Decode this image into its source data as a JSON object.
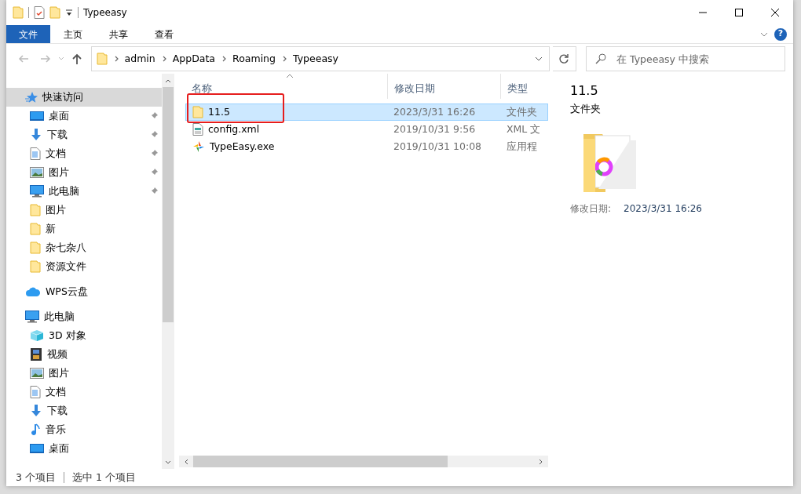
{
  "window": {
    "title": "Typeeasy"
  },
  "ribbon_tabs": [
    {
      "label": "文件",
      "selected": true
    },
    {
      "label": "主页",
      "selected": false
    },
    {
      "label": "共享",
      "selected": false
    },
    {
      "label": "查看",
      "selected": false
    }
  ],
  "help_glyph": "?",
  "address": {
    "crumbs": [
      "admin",
      "AppData",
      "Roaming",
      "Typeeasy"
    ]
  },
  "search": {
    "placeholder": "在 Typeeasy 中搜索"
  },
  "nav": [
    {
      "label": "快速访问",
      "kind": "star",
      "selected": true,
      "children": [
        {
          "label": "桌面",
          "kind": "desktop",
          "pinned": true
        },
        {
          "label": "下载",
          "kind": "download",
          "pinned": true
        },
        {
          "label": "文档",
          "kind": "document",
          "pinned": true
        },
        {
          "label": "图片",
          "kind": "picture",
          "pinned": true
        },
        {
          "label": "此电脑",
          "kind": "pc",
          "pinned": true
        },
        {
          "label": "图片",
          "kind": "folder",
          "pinned": false
        },
        {
          "label": "新",
          "kind": "folder",
          "pinned": false
        },
        {
          "label": "杂七杂八",
          "kind": "folder",
          "pinned": false
        },
        {
          "label": "资源文件",
          "kind": "folder",
          "pinned": false
        }
      ]
    },
    {
      "label": "WPS云盘",
      "kind": "cloud",
      "selected": false
    },
    {
      "label": "此电脑",
      "kind": "pc",
      "selected": false,
      "children": [
        {
          "label": "3D 对象",
          "kind": "cube",
          "pinned": false
        },
        {
          "label": "视频",
          "kind": "video",
          "pinned": false
        },
        {
          "label": "图片",
          "kind": "picture",
          "pinned": false
        },
        {
          "label": "文档",
          "kind": "document",
          "pinned": false
        },
        {
          "label": "下载",
          "kind": "download",
          "pinned": false
        },
        {
          "label": "音乐",
          "kind": "music",
          "pinned": false
        },
        {
          "label": "桌面",
          "kind": "desktop",
          "pinned": false
        }
      ]
    }
  ],
  "columns": [
    "名称",
    "修改日期",
    "类型"
  ],
  "files": [
    {
      "name": "11.5",
      "date": "2023/3/31 16:26",
      "type": "文件夹",
      "kind": "folder",
      "selected": true
    },
    {
      "name": "config.xml",
      "date": "2019/10/31 9:56",
      "type": "XML 文",
      "kind": "xml",
      "selected": false
    },
    {
      "name": "TypeEasy.exe",
      "date": "2019/10/31 10:08",
      "type": "应用程",
      "kind": "app",
      "selected": false
    }
  ],
  "preview": {
    "name": "11.5",
    "type": "文件夹",
    "date_label": "修改日期:",
    "date": "2023/3/31 16:26"
  },
  "status_bar": [
    "3 个项目",
    "选中 1 个项目"
  ]
}
